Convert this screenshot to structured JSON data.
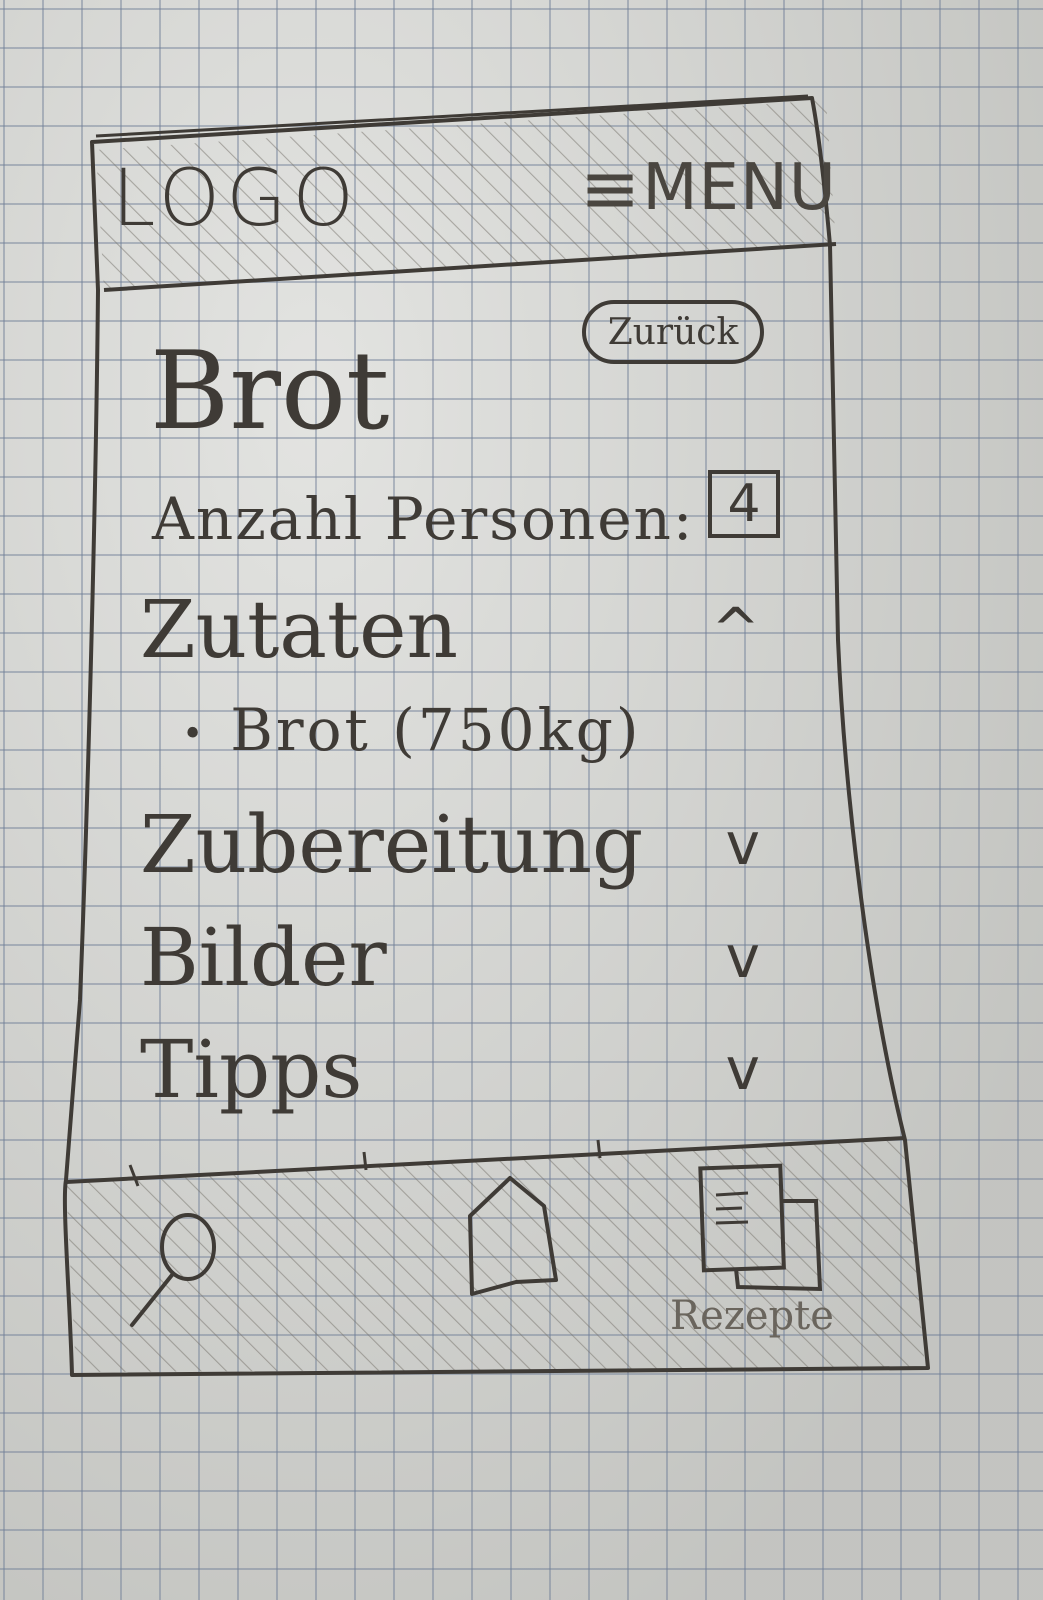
{
  "header": {
    "logo": "LOGO",
    "menu_icon": "≡",
    "menu_label": "MENU"
  },
  "back_button": {
    "label": "Zurück"
  },
  "recipe": {
    "title": "Brot",
    "persons_label": "Anzahl Personen:",
    "persons_value": "4"
  },
  "sections": [
    {
      "label": "Zutaten",
      "chevron": "^",
      "expanded": true,
      "items": [
        {
          "bullet": "•",
          "text": "Brot (750kg)"
        }
      ]
    },
    {
      "label": "Zubereitung",
      "chevron": "v",
      "expanded": false
    },
    {
      "label": "Bilder",
      "chevron": "v",
      "expanded": false
    },
    {
      "label": "Tipps",
      "chevron": "v",
      "expanded": false
    }
  ],
  "bottom_nav": {
    "search_icon": "search-icon",
    "home_icon": "home-icon",
    "recipes_icon": "recipe-book-icon",
    "recipes_label": "Rezepte"
  }
}
